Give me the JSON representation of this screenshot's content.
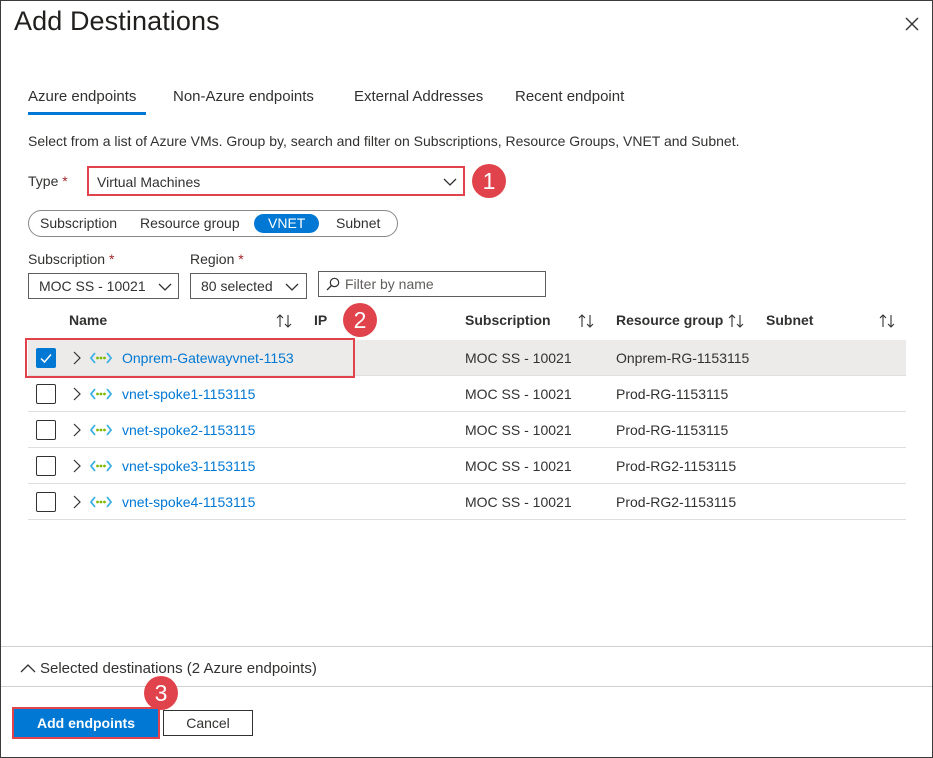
{
  "dialog": {
    "title": "Add Destinations",
    "close_icon": "close-icon"
  },
  "tabs": [
    {
      "label": "Azure endpoints",
      "active": true
    },
    {
      "label": "Non-Azure endpoints",
      "active": false
    },
    {
      "label": "External Addresses",
      "active": false
    },
    {
      "label": "Recent endpoint",
      "active": false
    }
  ],
  "description": "Select from a list of Azure VMs. Group by, search and filter on Subscriptions, Resource Groups, VNET and Subnet.",
  "type_field": {
    "label": "Type",
    "required_mark": "*",
    "value": "Virtual Machines"
  },
  "group_by": [
    {
      "label": "Subscription",
      "active": false
    },
    {
      "label": "Resource group",
      "active": false
    },
    {
      "label": "VNET",
      "active": true
    },
    {
      "label": "Subnet",
      "active": false
    }
  ],
  "filters": {
    "subscription": {
      "label": "Subscription",
      "required_mark": "*",
      "value": "MOC SS - 10021"
    },
    "region": {
      "label": "Region",
      "required_mark": "*",
      "value": "80 selected"
    },
    "search": {
      "placeholder": "Filter by name"
    }
  },
  "table": {
    "columns": [
      "Name",
      "IP",
      "Subscription",
      "Resource group",
      "Subnet"
    ],
    "rows": [
      {
        "checked": true,
        "name": "Onprem-Gatewayvnet-1153",
        "subscription": "MOC SS - 10021",
        "resource_group": "Onprem-RG-1153115"
      },
      {
        "checked": false,
        "name": "vnet-spoke1-1153115",
        "subscription": "MOC SS - 10021",
        "resource_group": "Prod-RG-1153115"
      },
      {
        "checked": false,
        "name": "vnet-spoke2-1153115",
        "subscription": "MOC SS - 10021",
        "resource_group": "Prod-RG-1153115"
      },
      {
        "checked": false,
        "name": "vnet-spoke3-1153115",
        "subscription": "MOC SS - 10021",
        "resource_group": "Prod-RG2-1153115"
      },
      {
        "checked": false,
        "name": "vnet-spoke4-1153115",
        "subscription": "MOC SS - 10021",
        "resource_group": "Prod-RG2-1153115"
      }
    ]
  },
  "selected_destinations": "Selected destinations (2 Azure endpoints)",
  "buttons": {
    "primary": "Add endpoints",
    "secondary": "Cancel"
  },
  "callouts": [
    "1",
    "2",
    "3"
  ],
  "colors": {
    "accent": "#0078d4",
    "callout": "#e0434b",
    "required": "#a4262c"
  }
}
